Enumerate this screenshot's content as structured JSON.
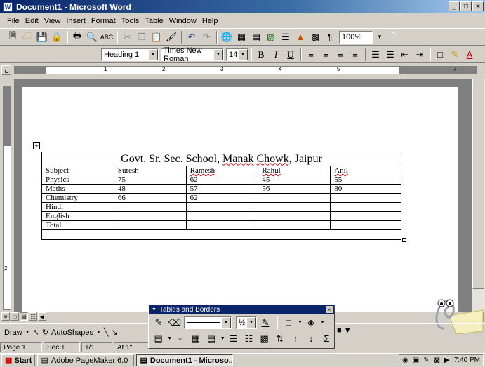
{
  "window": {
    "title": "Document1 - Microsoft Word",
    "minimize": "_",
    "restore": "1",
    "close": "x"
  },
  "menu": [
    "File",
    "Edit",
    "View",
    "Insert",
    "Format",
    "Tools",
    "Table",
    "Window",
    "Help"
  ],
  "standard_toolbar": {
    "zoom": "100%"
  },
  "formatting_toolbar": {
    "style": "Heading 1",
    "font": "Times New Roman",
    "size": "14",
    "bold": "B",
    "italic": "I",
    "underline": "U"
  },
  "ruler": {
    "numbers": [
      "1",
      "2",
      "3",
      "4",
      "5",
      "7"
    ]
  },
  "vruler": {
    "number": "2"
  },
  "table": {
    "title": "Govt. Sr. Sec. School, Manak Chowk, Jaipur",
    "rows": [
      [
        "Subject",
        "Suresh",
        "Ramesh",
        "Rahul",
        "Anil"
      ],
      [
        "Physics",
        "75",
        "62",
        "45",
        "55"
      ],
      [
        "Maths",
        "48",
        "57",
        "56",
        "80"
      ],
      [
        "Chemistry",
        "66",
        "62",
        "",
        ""
      ],
      [
        "Hindi",
        "",
        "",
        "",
        ""
      ],
      [
        "English",
        "",
        "",
        "",
        ""
      ],
      [
        "Total",
        "",
        "",
        "",
        ""
      ]
    ]
  },
  "tables_borders": {
    "title": "Tables and Borders",
    "line_weight": "½",
    "close": "x"
  },
  "draw_toolbar": {
    "draw": "Draw",
    "autoshapes": "AutoShapes"
  },
  "status": {
    "page": "Page 1",
    "sec": "Sec 1",
    "pages": "1/1",
    "at": "At 1\""
  },
  "taskbar": {
    "start": "Start",
    "task1": "Adobe PageMaker 6.0",
    "task2": "Document1 - Microso...",
    "time": "7:40 PM"
  }
}
